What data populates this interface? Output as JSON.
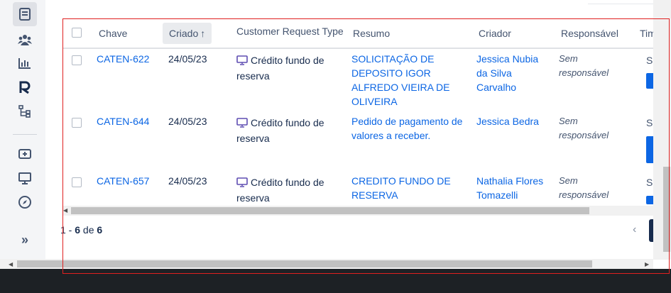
{
  "sidebar": {
    "items": [
      {
        "icon": "queue-list-icon",
        "active": true
      },
      {
        "icon": "customers-icon"
      },
      {
        "icon": "reports-icon"
      },
      {
        "icon": "r-logo-icon"
      },
      {
        "icon": "workflow-tree-icon"
      },
      {
        "icon": "add-item-icon"
      },
      {
        "icon": "monitor-icon"
      },
      {
        "icon": "compass-icon"
      },
      {
        "icon": "expand-chevrons-icon",
        "label": "»"
      }
    ]
  },
  "table": {
    "columns": [
      "Chave",
      "Criado",
      "Customer Request Type",
      "Resumo",
      "Criador",
      "Responsável",
      "Tim"
    ],
    "sorted_column": "Criado",
    "sort_arrow": "↑",
    "rows": [
      {
        "key": "CATEN-622",
        "created": "24/05/23",
        "request_type": "Crédito fundo de reserva",
        "summary": "SOLICITAÇÃO DE DEPOSITO IGOR ALFREDO VIEIRA DE OLIVEIRA",
        "creator": "Jessica Nubia da Silva Carvalho",
        "assignee": "Sem responsável",
        "extra": "S"
      },
      {
        "key": "CATEN-644",
        "created": "24/05/23",
        "request_type": "Crédito fundo de reserva",
        "summary": "Pedido de pagamento de valores a receber.",
        "creator": "Jessica Bedra",
        "assignee": "Sem responsável",
        "extra": "S"
      },
      {
        "key": "CATEN-657",
        "created": "24/05/23",
        "request_type": "Crédito fundo de reserva",
        "summary": "CREDITO FUNDO DE RESERVA",
        "creator": "Nathalia Flores Tomazelli",
        "assignee": "Sem responsável",
        "extra": "S"
      }
    ]
  },
  "pagination": {
    "start": "1",
    "sep": " - ",
    "end": "6",
    "of": " de ",
    "total": "6",
    "prev": "‹"
  },
  "colors": {
    "link": "#0c66e4",
    "accent_red_outline": "#e02020"
  }
}
